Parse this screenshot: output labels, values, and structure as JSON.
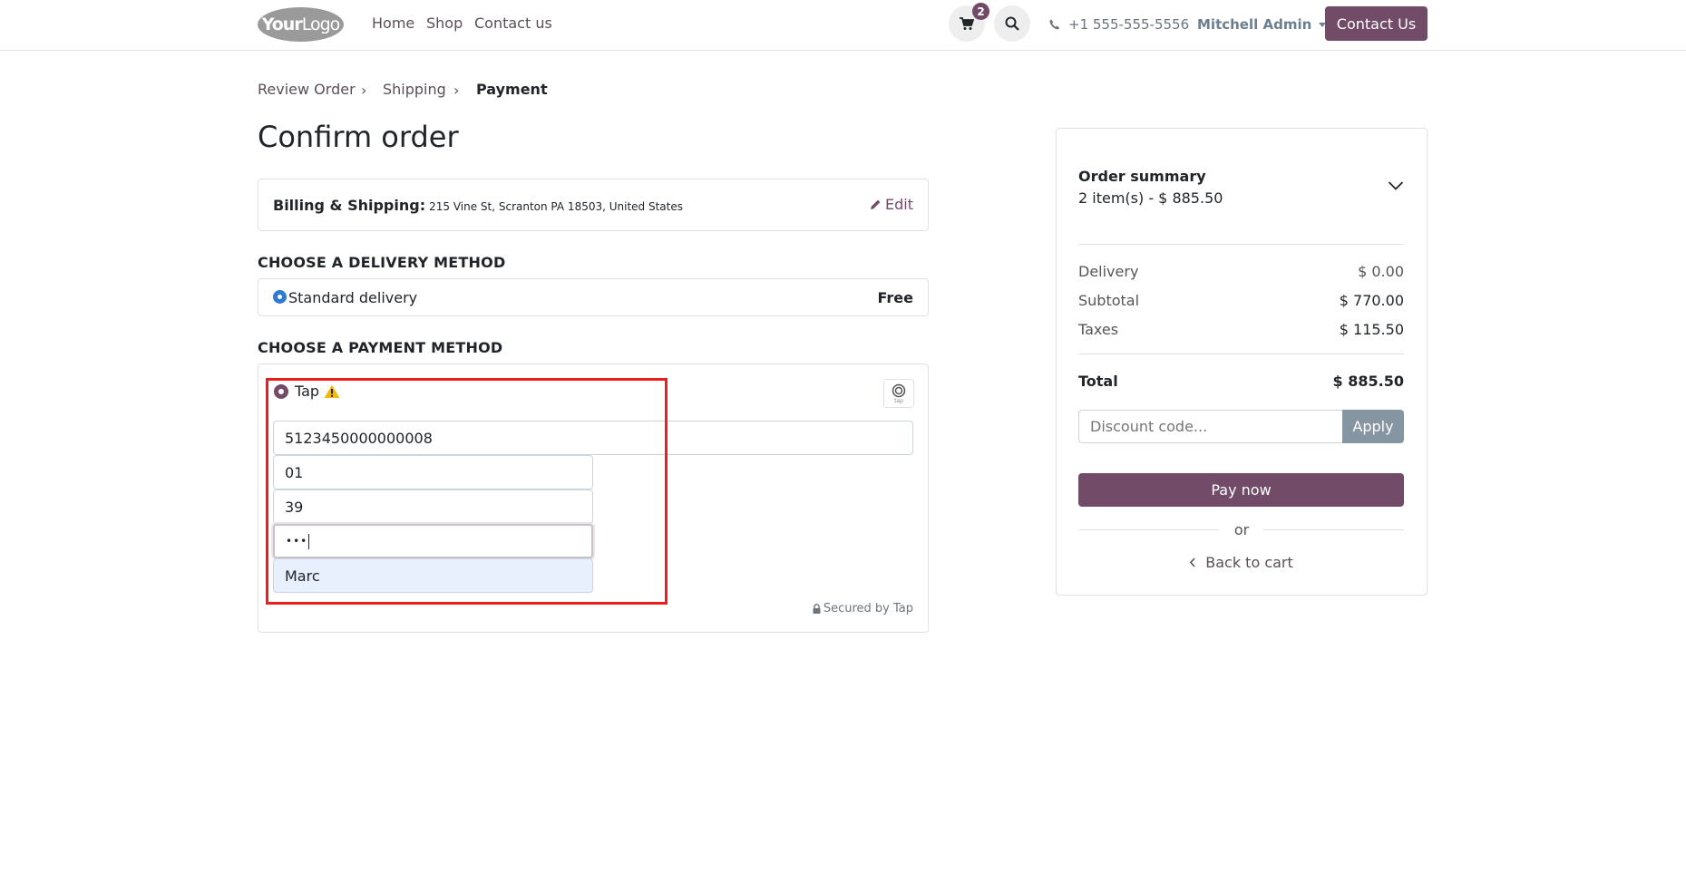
{
  "header": {
    "logo_main": "Your",
    "logo_thin": "Logo",
    "nav": [
      "Home",
      "Shop",
      "Contact us"
    ],
    "cart_count": "2",
    "phone": "+1 555-555-5556",
    "user": "Mitchell Admin",
    "contact_button": "Contact Us"
  },
  "breadcrumb": {
    "step1": "Review Order",
    "step2": "Shipping",
    "step3": "Payment"
  },
  "page_title": "Confirm order",
  "billing": {
    "label": "Billing & Shipping:",
    "address": "215 Vine St, Scranton PA 18503, United States",
    "edit": "Edit"
  },
  "delivery": {
    "section_title": "CHOOSE A DELIVERY METHOD",
    "option": "Standard delivery",
    "price": "Free"
  },
  "payment": {
    "section_title": "CHOOSE A PAYMENT METHOD",
    "provider": "Tap",
    "provider_logo_text": "tap",
    "card_number": "5123450000000008",
    "exp_month": "01",
    "exp_year": "39",
    "cvc": "•••",
    "holder_name": "Marc",
    "secured_by": "Secured by Tap"
  },
  "summary": {
    "title": "Order summary",
    "items": "2 item(s) -  $ 885.50",
    "delivery_label": "Delivery",
    "delivery_value": "$ 0.00",
    "subtotal_label": "Subtotal",
    "subtotal_value": "$ 770.00",
    "taxes_label": "Taxes",
    "taxes_value": "$ 115.50",
    "total_label": "Total",
    "total_value": "$ 885.50",
    "discount_placeholder": "Discount code...",
    "apply": "Apply",
    "pay_now": "Pay now",
    "or": "or",
    "back_to_cart": "Back to cart"
  },
  "colors": {
    "brand": "#714b67",
    "highlight": "#ee1c1c",
    "selected_field": "#e8f0fe"
  }
}
